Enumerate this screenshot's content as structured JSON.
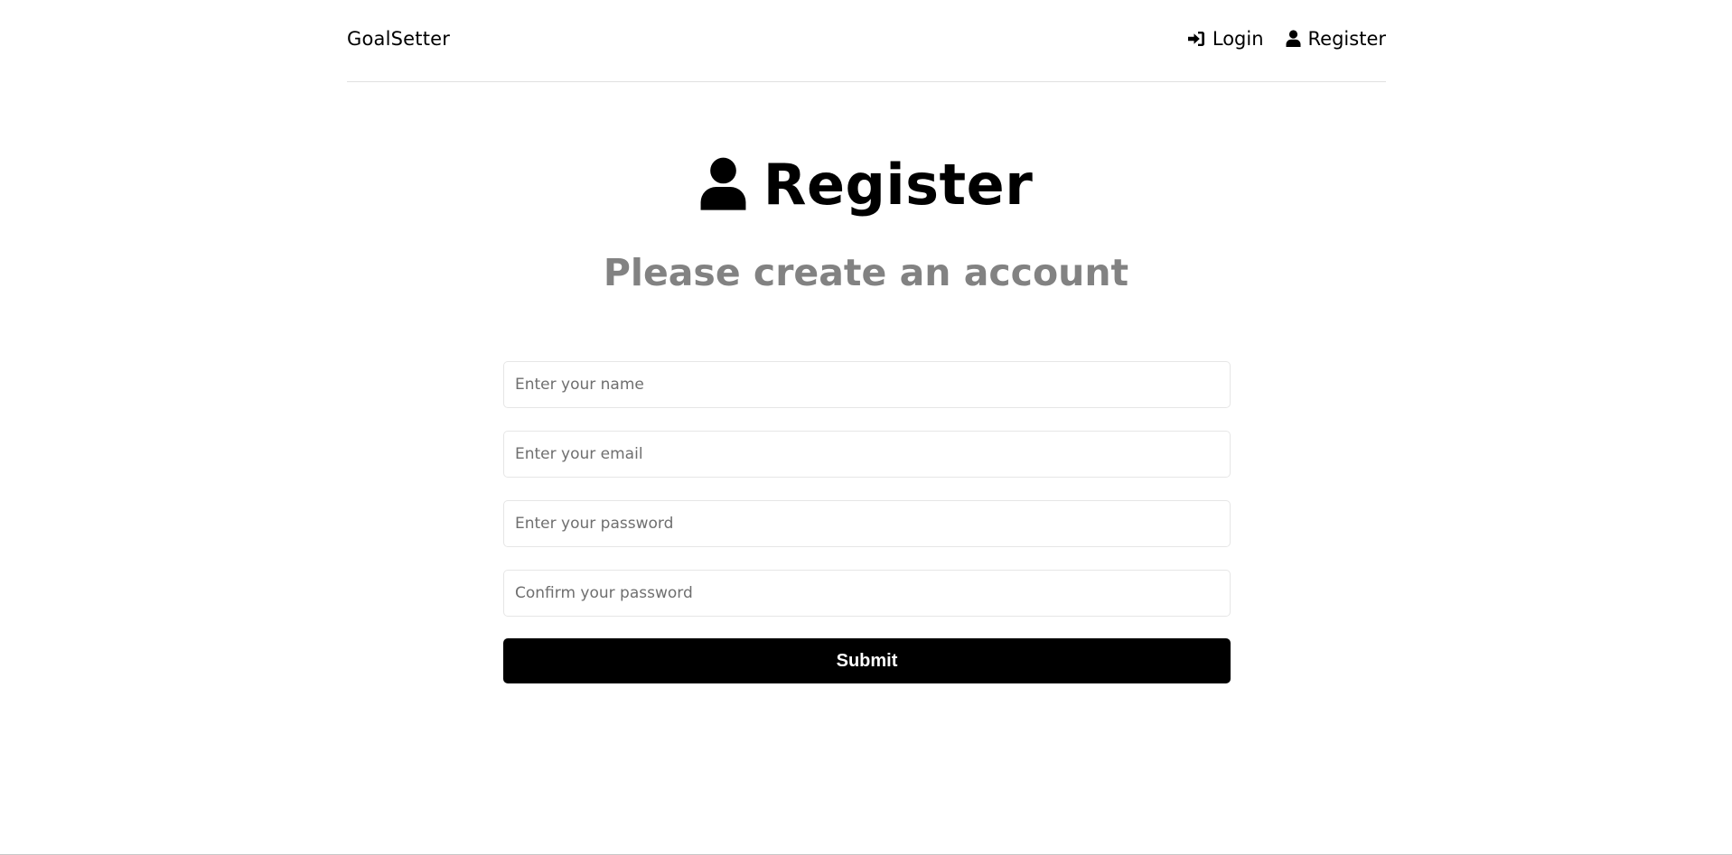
{
  "header": {
    "brand": "GoalSetter",
    "nav": [
      {
        "label": "Login",
        "icon": "sign-in-icon"
      },
      {
        "label": "Register",
        "icon": "user-icon"
      }
    ]
  },
  "main": {
    "title": "Register",
    "title_icon": "user-icon",
    "subtitle": "Please create an account"
  },
  "form": {
    "name_placeholder": "Enter your name",
    "email_placeholder": "Enter your email",
    "password_placeholder": "Enter your password",
    "confirm_placeholder": "Confirm your password",
    "submit_label": "Submit"
  },
  "colors": {
    "subtitle": "#828282",
    "button_bg": "#000000",
    "button_text": "#ffffff"
  }
}
